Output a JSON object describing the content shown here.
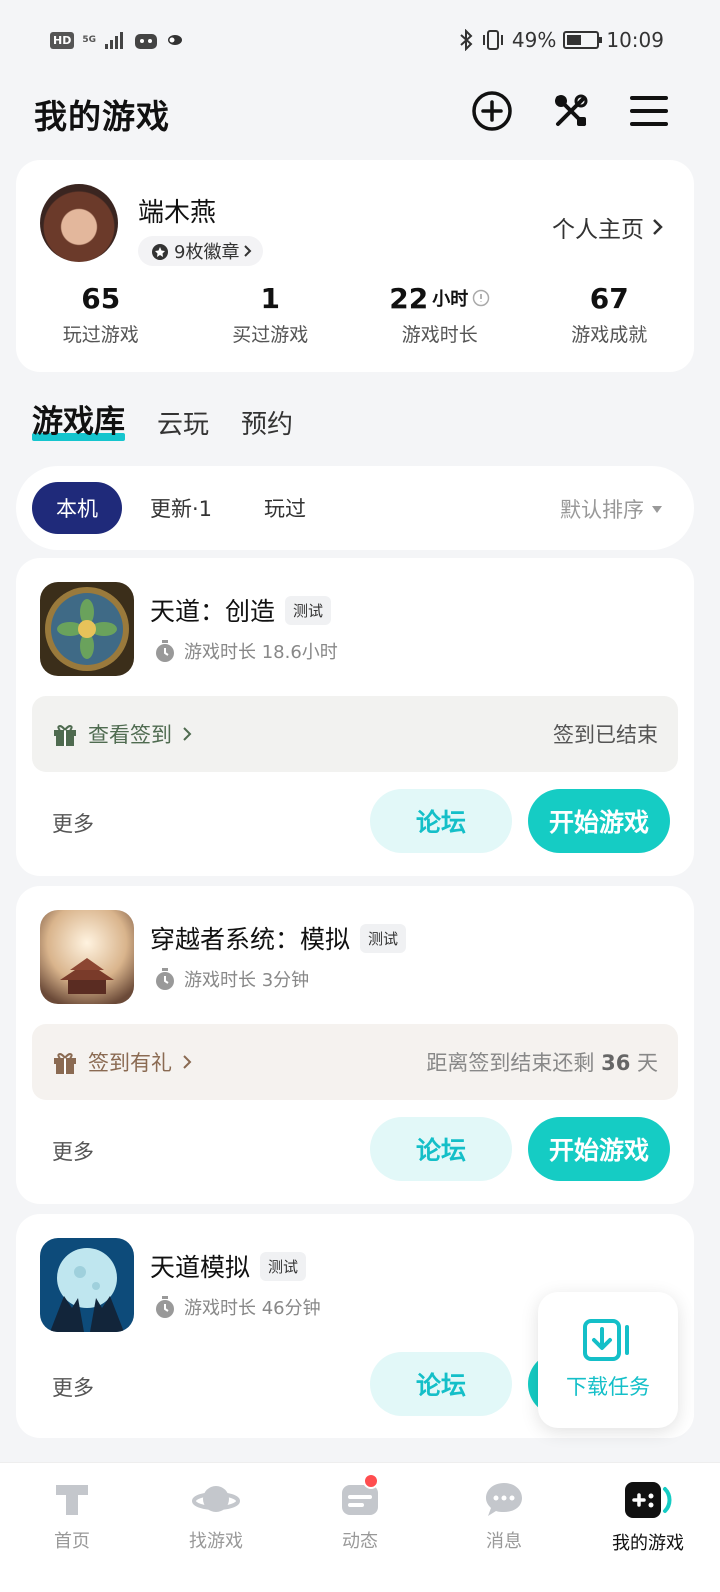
{
  "status_bar": {
    "hd": "HD",
    "signal": "5G",
    "battery": "49%",
    "battery_fraction": 0.49,
    "time": "10:09"
  },
  "header": {
    "title": "我的游戏"
  },
  "profile": {
    "name": "端木燕",
    "badges": "9枚徽章",
    "home_link": "个人主页",
    "stats": [
      {
        "value": "65",
        "unit": "",
        "label": "玩过游戏"
      },
      {
        "value": "1",
        "unit": "",
        "label": "买过游戏"
      },
      {
        "value": "22",
        "unit": "小时",
        "label": "游戏时长"
      },
      {
        "value": "67",
        "unit": "",
        "label": "游戏成就"
      }
    ]
  },
  "library_tabs": [
    "游戏库",
    "云玩",
    "预约"
  ],
  "filters": {
    "items": [
      "本机",
      "更新·1",
      "玩过"
    ],
    "sort": "默认排序"
  },
  "games": [
    {
      "title": "天道：创造",
      "tag": "测试",
      "playtime": "游戏时长 18.6小时",
      "signin_left": "查看签到",
      "signin_right": "签到已结束",
      "more": "更多",
      "forum": "论坛",
      "play": "开始游戏"
    },
    {
      "title": "穿越者系统：模拟",
      "tag": "测试",
      "playtime": "游戏时长 3分钟",
      "signin_left": "签到有礼",
      "signin_right_prefix": "距离签到结束还剩",
      "signin_right_days": "36",
      "signin_right_suffix": "天",
      "more": "更多",
      "forum": "论坛",
      "play": "开始游戏"
    },
    {
      "title": "天道模拟",
      "tag": "测试",
      "playtime": "游戏时长 46分钟",
      "more": "更多",
      "forum": "论坛"
    }
  ],
  "download_task": {
    "label": "下载任务"
  },
  "bottom_nav": [
    "首页",
    "找游戏",
    "动态",
    "消息",
    "我的游戏"
  ],
  "colors": {
    "accent": "#15ccc4",
    "filter_active": "#1f2a7a",
    "signin_green": "#4f6b50",
    "signin_brown": "#8a6a52"
  }
}
